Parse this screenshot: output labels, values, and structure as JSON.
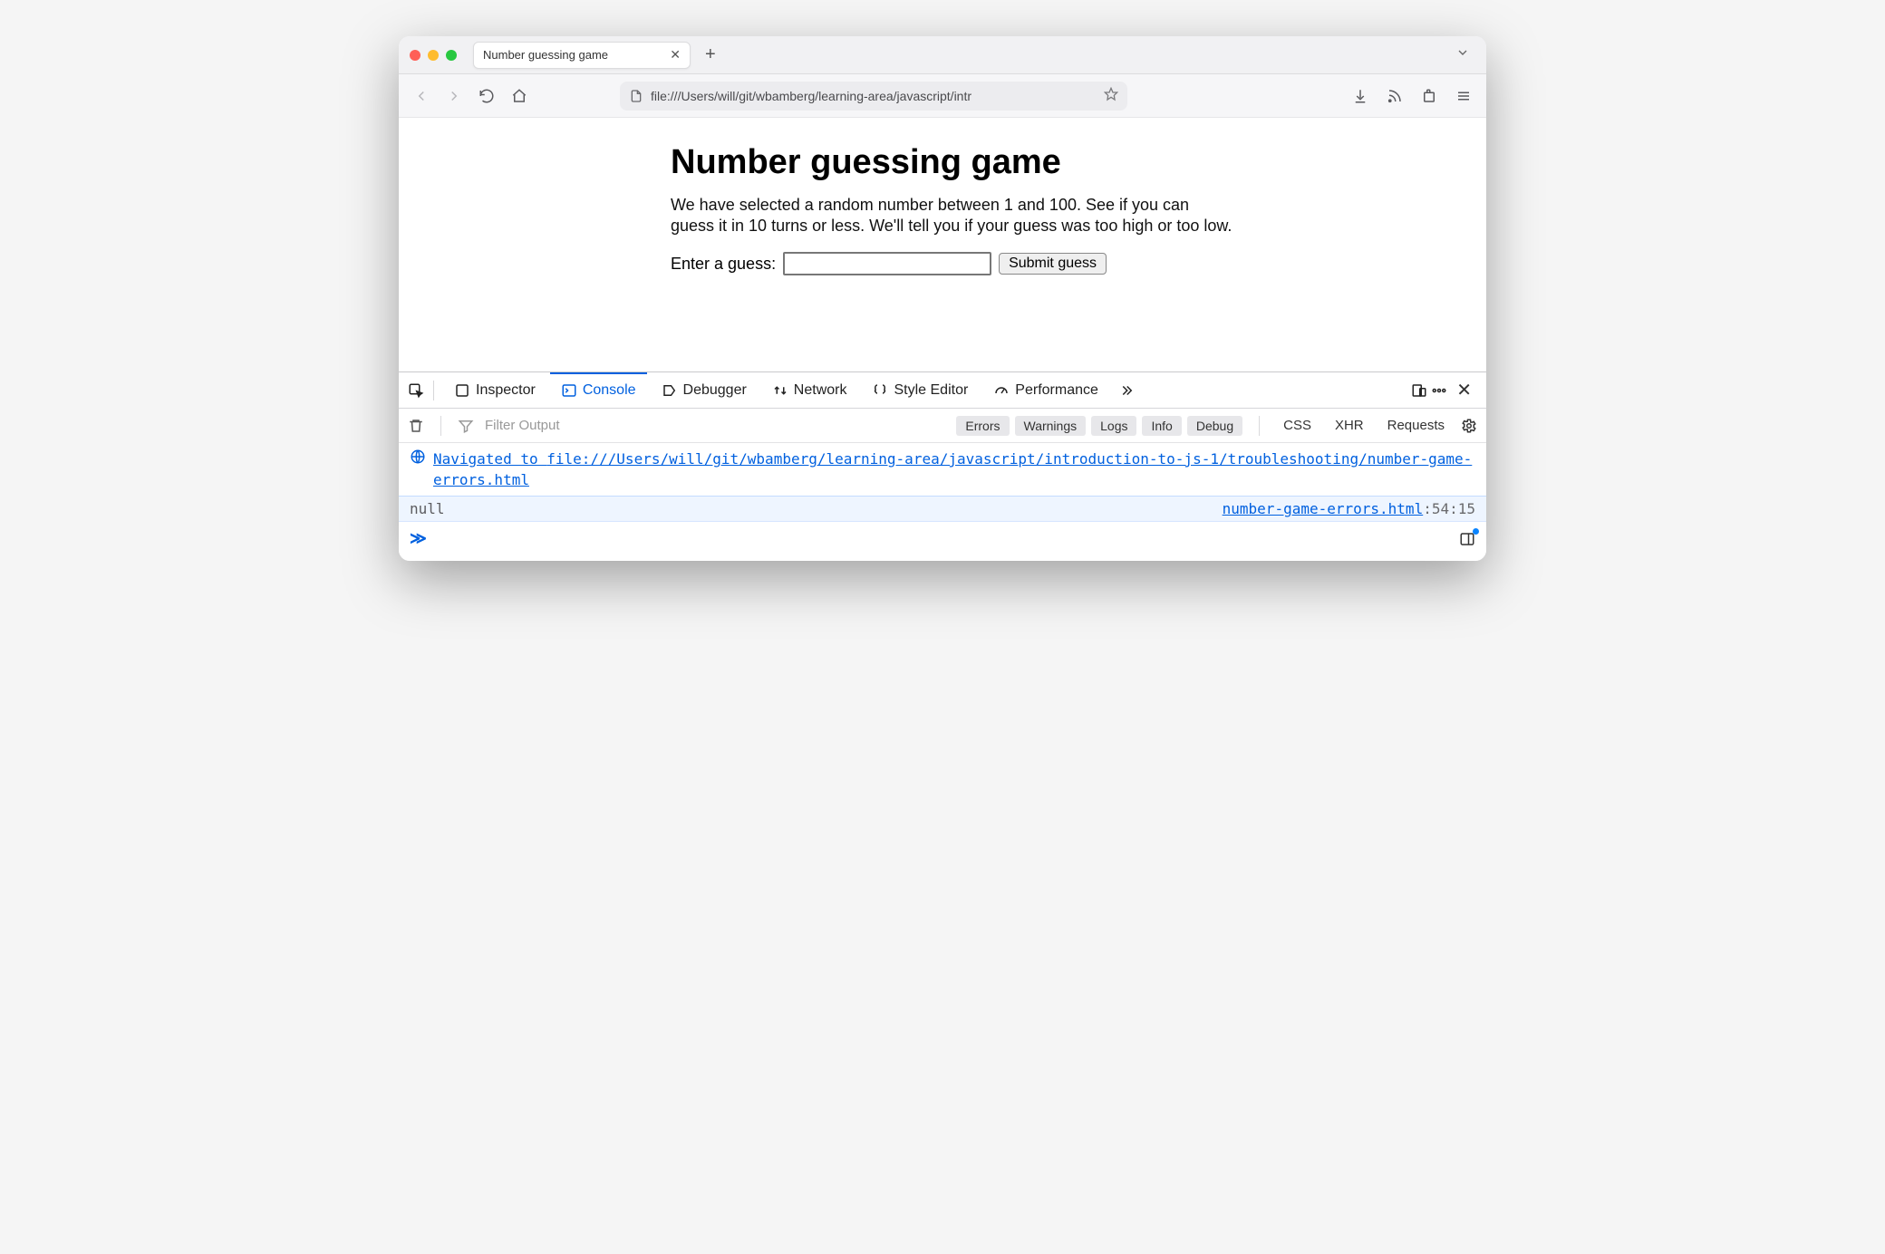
{
  "browser": {
    "tab_title": "Number guessing game",
    "url": "file:///Users/will/git/wbamberg/learning-area/javascript/intr"
  },
  "page": {
    "heading": "Number guessing game",
    "intro": "We have selected a random number between 1 and 100. See if you can guess it in 10 turns or less. We'll tell you if your guess was too high or too low.",
    "label": "Enter a guess:",
    "input_value": "",
    "submit_label": "Submit guess"
  },
  "devtools": {
    "tabs": {
      "inspector": "Inspector",
      "console": "Console",
      "debugger": "Debugger",
      "network": "Network",
      "styleeditor": "Style Editor",
      "performance": "Performance"
    },
    "filter_placeholder": "Filter Output",
    "level_chips": {
      "errors": "Errors",
      "warnings": "Warnings",
      "logs": "Logs",
      "info": "Info",
      "debug": "Debug"
    },
    "toggles": {
      "css": "CSS",
      "xhr": "XHR",
      "requests": "Requests"
    },
    "nav_message_prefix": "Navigated to ",
    "nav_message_url": "file:///Users/will/git/wbamberg/learning-area/javascript/introduction-to-js-1/troubleshooting/number-game-errors.html",
    "log_value": "null",
    "log_source_file": "number-game-errors.html",
    "log_source_loc": ":54:15"
  }
}
